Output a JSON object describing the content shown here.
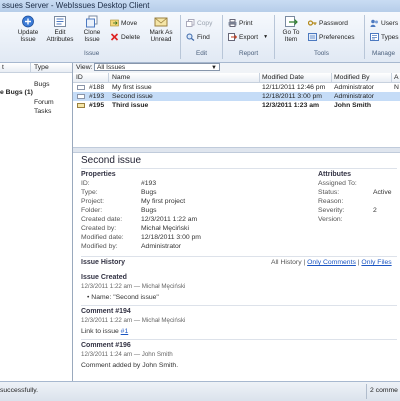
{
  "window": {
    "title": "ssues Server - WebIssues Desktop Client"
  },
  "toolbar": {
    "update_issue": "Update\nIssue",
    "edit_attributes": "Edit\nAttributes",
    "clone_issue": "Clone\nIssue",
    "move": "Move",
    "delete": "Delete",
    "mark_as_unread": "Mark As\nUnread",
    "copy": "Copy",
    "find": "Find",
    "print": "Print",
    "export": "Export",
    "go_to_item": "Go To\nItem",
    "password": "Password",
    "preferences": "Preferences",
    "users": "Users",
    "types": "Types",
    "group_issue": "Issue",
    "group_edit": "Edit",
    "group_report": "Report",
    "group_tools": "Tools",
    "group_manage": "Manage"
  },
  "left_pane": {
    "col_name": "t",
    "col_type": "Type",
    "items": [
      {
        "name": "",
        "type": "Bugs",
        "bold": false
      },
      {
        "name": "e Bugs (1)",
        "type": "",
        "bold": true
      },
      {
        "name": "",
        "type": "Forum",
        "bold": false
      },
      {
        "name": "",
        "type": "Tasks",
        "bold": false
      }
    ]
  },
  "list": {
    "view_label": "View:",
    "view_value": "All Issues",
    "columns": {
      "id": "ID",
      "name": "Name",
      "modified_date": "Modified Date",
      "modified_by": "Modified By",
      "extra": "A"
    },
    "rows": [
      {
        "id": "#188",
        "name": "My first issue",
        "modified_date": "12/11/2011 12:46 pm",
        "modified_by": "Administrator",
        "extra": "N",
        "unread": false,
        "selected": false
      },
      {
        "id": "#193",
        "name": "Second issue",
        "modified_date": "12/18/2011 3:00 pm",
        "modified_by": "Administrator",
        "extra": "",
        "unread": false,
        "selected": true
      },
      {
        "id": "#195",
        "name": "Third issue",
        "modified_date": "12/3/2011 1:23 am",
        "modified_by": "John Smith",
        "extra": "",
        "unread": true,
        "selected": false
      }
    ]
  },
  "details": {
    "title": "Second issue",
    "properties_heading": "Properties",
    "properties": [
      {
        "label": "ID:",
        "value": "#193"
      },
      {
        "label": "Type:",
        "value": "Bugs"
      },
      {
        "label": "Project:",
        "value": "My first project"
      },
      {
        "label": "Folder:",
        "value": "Bugs"
      },
      {
        "label": "Created date:",
        "value": "12/3/2011 1:22 am"
      },
      {
        "label": "Created by:",
        "value": "Michał Męciński"
      },
      {
        "label": "Modified date:",
        "value": "12/18/2011 3:00 pm"
      },
      {
        "label": "Modified by:",
        "value": "Administrator"
      }
    ],
    "attributes_heading": "Attributes",
    "attributes": [
      {
        "label": "Assigned To:",
        "value": ""
      },
      {
        "label": "Status:",
        "value": "Active"
      },
      {
        "label": "Reason:",
        "value": ""
      },
      {
        "label": "Severity:",
        "value": "2"
      },
      {
        "label": "Version:",
        "value": ""
      }
    ],
    "history_heading": "Issue History",
    "history_filters": {
      "all": "All History",
      "sep1": "|",
      "comments": "Only Comments",
      "sep2": "|",
      "files": "Only Files"
    },
    "history": [
      {
        "heading": "Issue Created",
        "meta": "12/3/2011 1:22 am — Michał Męciński",
        "body": "Name: \"Second issue\""
      },
      {
        "heading": "Comment #194",
        "meta": "12/3/2011 1:22 am — Michał Męciński",
        "body_prefix": "Link to issue",
        "body_link": "#1"
      },
      {
        "heading": "Comment #196",
        "meta": "12/3/2011 1:24 am — John Smith",
        "body": "Comment added by John Smith."
      }
    ]
  },
  "status": {
    "left": " successfully.",
    "right": "2 comme"
  }
}
